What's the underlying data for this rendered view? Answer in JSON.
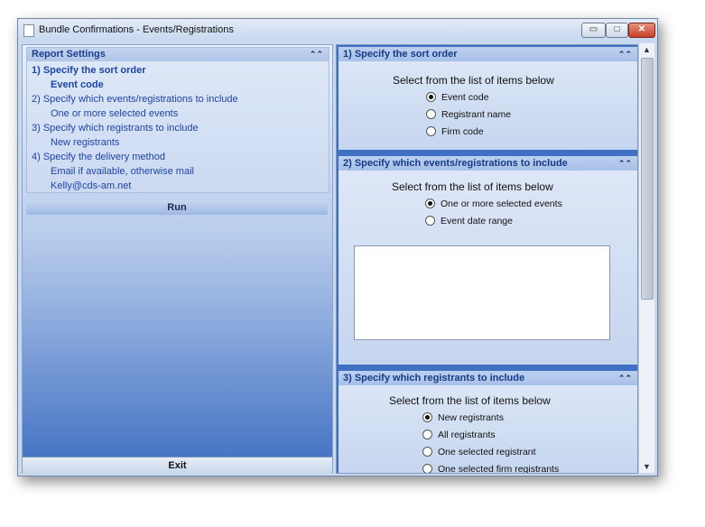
{
  "window": {
    "title": "Bundle Confirmations - Events/Registrations"
  },
  "report_settings": {
    "header": "Report Settings",
    "items": [
      {
        "label": "1)  Specify the sort order",
        "value": "Event code"
      },
      {
        "label": "2)  Specify which events/registrations to include",
        "value": "One or more selected events"
      },
      {
        "label": "3)  Specify which registrants to include",
        "value": "New registrants"
      },
      {
        "label": "4)  Specify the delivery method",
        "value": "Email if available, otherwise mail",
        "extra": "Kelly@cds-am.net"
      }
    ]
  },
  "run_label": "Run",
  "exit_label": "Exit",
  "sections": [
    {
      "header": "1)  Specify the sort order",
      "prompt": "Select from the list of items below",
      "options": [
        "Event code",
        "Registrant name",
        "Firm code"
      ],
      "selected": 0
    },
    {
      "header": "2)  Specify which events/registrations to include",
      "prompt": "Select from the list of items below",
      "options": [
        "One or more selected events",
        "Event date range"
      ],
      "selected": 0
    },
    {
      "header": "3)  Specify which registrants to include",
      "prompt": "Select from the list of items below",
      "options": [
        "New registrants",
        "All registrants",
        "One selected registrant",
        "One selected firm registrants"
      ],
      "selected": 0
    }
  ],
  "icons": {
    "collapse": "double-chevron-up-icon",
    "scroll_up": "arrow-up-icon",
    "scroll_down": "arrow-down-icon"
  }
}
